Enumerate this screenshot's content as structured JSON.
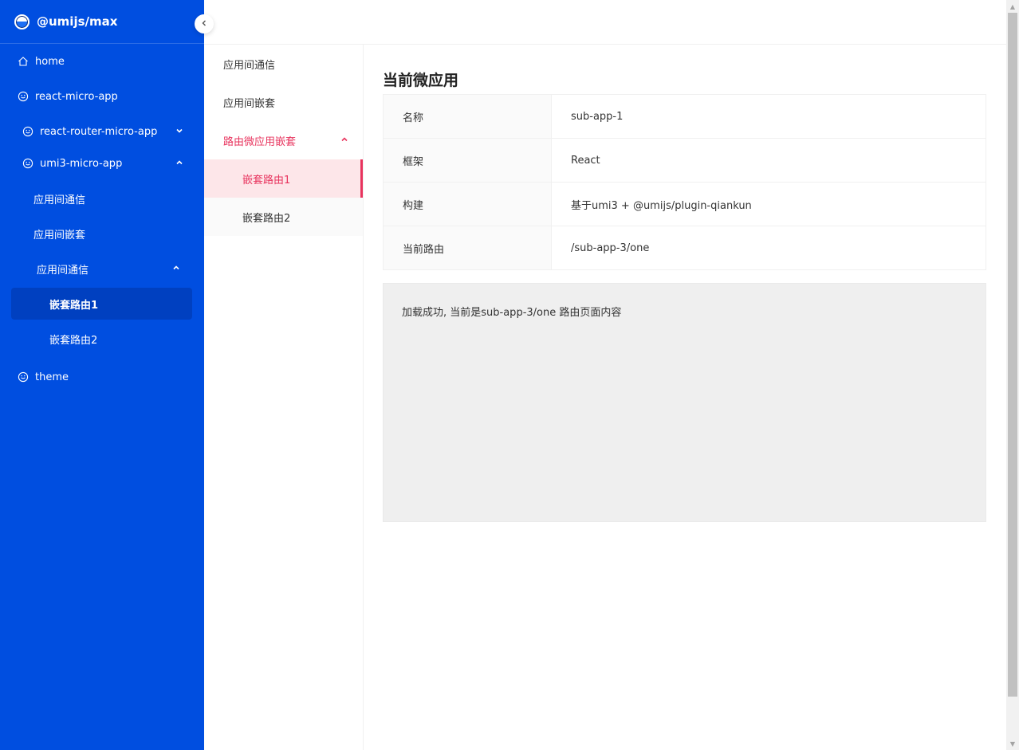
{
  "brand": {
    "title": "@umijs/max"
  },
  "sidebar": {
    "items": [
      {
        "label": "home",
        "icon": "home-icon"
      },
      {
        "label": "react-micro-app",
        "icon": "smile-icon"
      },
      {
        "label": "react-router-micro-app",
        "icon": "smile-icon",
        "expanded": false
      },
      {
        "label": "umi3-micro-app",
        "icon": "smile-icon",
        "expanded": true
      },
      {
        "label": "应用间通信"
      },
      {
        "label": "应用间嵌套"
      },
      {
        "label": "应用间通信",
        "expanded": true
      },
      {
        "label": "嵌套路由1",
        "selected": true
      },
      {
        "label": "嵌套路由2"
      },
      {
        "label": "theme",
        "icon": "smile-icon"
      }
    ]
  },
  "subnav": {
    "items": [
      {
        "label": "应用间通信"
      },
      {
        "label": "应用间嵌套"
      },
      {
        "label": "路由微应用嵌套",
        "expanded": true
      },
      {
        "label": "嵌套路由1",
        "selected": true
      },
      {
        "label": "嵌套路由2"
      }
    ]
  },
  "main": {
    "title": "当前微应用",
    "rows": [
      {
        "label": "名称",
        "value": "sub-app-1"
      },
      {
        "label": "框架",
        "value": "React"
      },
      {
        "label": "构建",
        "value": "基于umi3 + @umijs/plugin-qiankun"
      },
      {
        "label": "当前路由",
        "value": "/sub-app-3/one"
      }
    ],
    "panel_text": "加载成功, 当前是sub-app-3/one 路由页面内容"
  },
  "colors": {
    "sidebar_bg": "#004ee0",
    "sidebar_selected_bg": "#0040c0",
    "accent": "#e8345e",
    "selected_item_bg": "#fde6e9"
  }
}
